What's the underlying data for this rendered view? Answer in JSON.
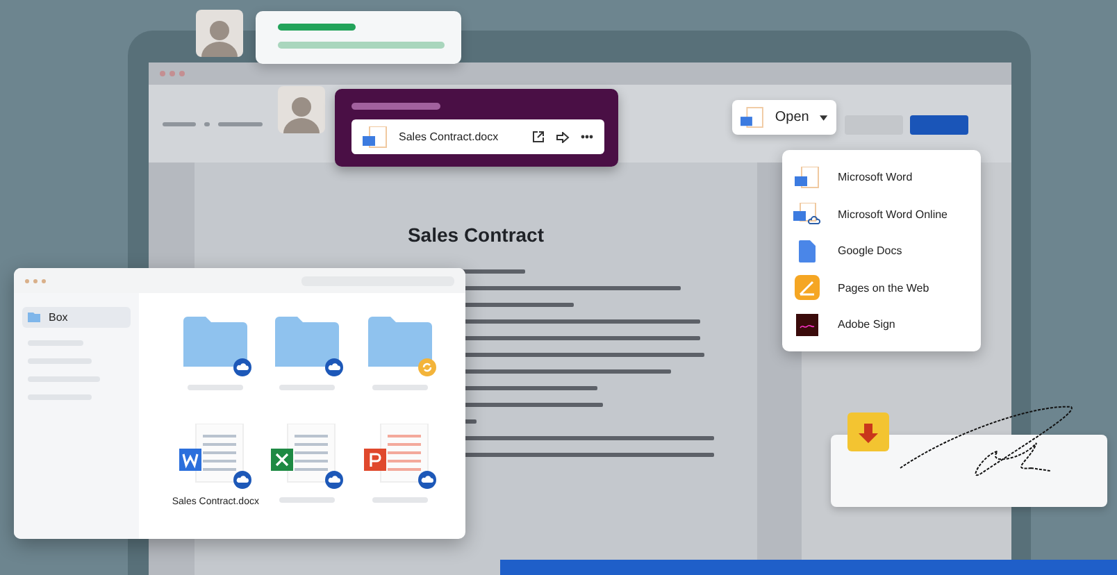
{
  "share_card": {
    "file_name": "Sales Contract.docx"
  },
  "open_button": {
    "label": "Open"
  },
  "open_menu": {
    "items": [
      {
        "kind": "word",
        "label": "Microsoft Word"
      },
      {
        "kind": "word-online",
        "label": "Microsoft Word Online"
      },
      {
        "kind": "google-docs",
        "label": "Google Docs"
      },
      {
        "kind": "pages",
        "label": "Pages on the Web"
      },
      {
        "kind": "adobe-sign",
        "label": "Adobe Sign"
      }
    ]
  },
  "document": {
    "title": "Sales Contract"
  },
  "file_browser": {
    "sidebar_items": [
      {
        "label": "Box",
        "selected": true
      }
    ],
    "files": [
      {
        "kind": "folder",
        "badge": {
          "kind": "cloud"
        }
      },
      {
        "kind": "folder",
        "badge": {
          "kind": "cloud"
        }
      },
      {
        "kind": "folder",
        "badge": {
          "kind": "sync"
        }
      },
      {
        "kind": "word",
        "badge": {
          "kind": "cloud"
        },
        "name": "Sales Contract.docx"
      },
      {
        "kind": "excel",
        "badge": {
          "kind": "cloud"
        }
      },
      {
        "kind": "powerpoint",
        "badge": {
          "kind": "cloud"
        }
      }
    ]
  }
}
